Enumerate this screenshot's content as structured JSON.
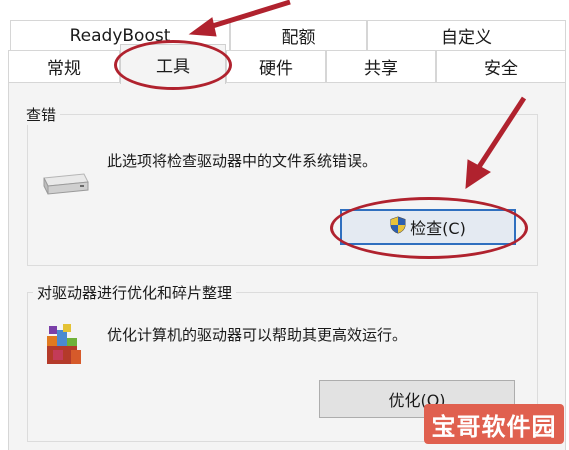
{
  "tabs_row1": [
    {
      "label": "ReadyBoost"
    },
    {
      "label": "配额"
    },
    {
      "label": "自定义"
    }
  ],
  "tabs_row2": [
    {
      "label": "常规"
    },
    {
      "label": "工具",
      "active": true
    },
    {
      "label": "硬件"
    },
    {
      "label": "共享"
    },
    {
      "label": "安全"
    }
  ],
  "error_check": {
    "title": "查错",
    "description": "此选项将检查驱动器中的文件系统错误。",
    "button_label": "检查(C)",
    "drive_icon": "drive-icon",
    "shield_icon": "uac-shield-icon"
  },
  "optimize": {
    "title": "对驱动器进行优化和碎片整理",
    "description": "优化计算机的驱动器可以帮助其更高效运行。",
    "button_label": "优化(O)",
    "defrag_icon": "defrag-icon"
  },
  "annotations": {
    "color": "#b0222e"
  },
  "watermark": {
    "text": "宝哥软件园",
    "color": "#e0604f"
  }
}
